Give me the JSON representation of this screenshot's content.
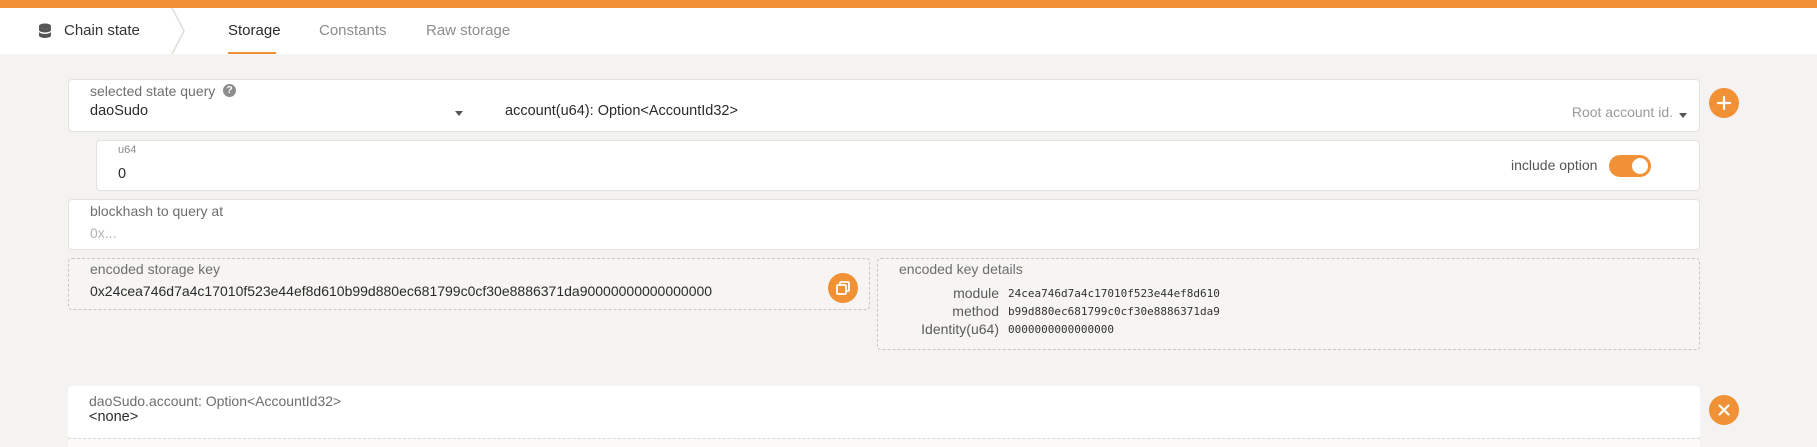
{
  "colors": {
    "accent": "#f19135",
    "background": "#f4f3f1"
  },
  "header": {
    "section_icon": "database-icon",
    "section_label": "Chain state",
    "tabs": [
      {
        "label": "Storage",
        "active": true
      },
      {
        "label": "Constants",
        "active": false
      },
      {
        "label": "Raw storage",
        "active": false
      }
    ]
  },
  "query": {
    "label": "selected state query",
    "module": "daoSudo",
    "method_signature": "account(u64): Option<AccountId32>",
    "method_hint": "Root account id.",
    "add_icon": "plus-icon"
  },
  "param": {
    "type_label": "u64",
    "value": "0",
    "include_option_label": "include option",
    "include_option_on": true
  },
  "blockhash": {
    "label": "blockhash to query at",
    "placeholder": "0x..."
  },
  "encoded_key": {
    "label": "encoded storage key",
    "value": "0x24cea746d7a4c17010f523e44ef8d610b99d880ec681799c0cf30e8886371da90000000000000000",
    "copy_icon": "copy-icon"
  },
  "key_details": {
    "label": "encoded key details",
    "rows": [
      {
        "name": "module",
        "value": "24cea746d7a4c17010f523e44ef8d610"
      },
      {
        "name": "method",
        "value": "b99d880ec681799c0cf30e8886371da9"
      },
      {
        "name": "Identity(u64)",
        "value": "0000000000000000"
      }
    ]
  },
  "result": {
    "label": "daoSudo.account: Option<AccountId32>",
    "value": "<none>",
    "close_icon": "close-icon"
  }
}
